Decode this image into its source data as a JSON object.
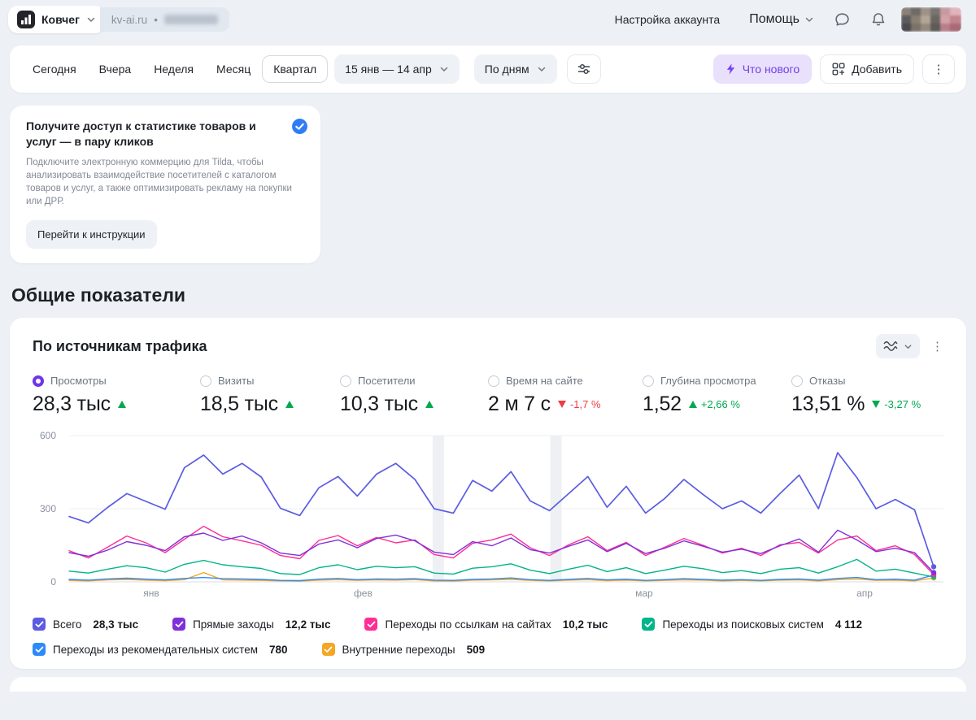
{
  "icons": {
    "kebab": "⋮"
  },
  "topbar": {
    "counter": {
      "name": "Ковчег",
      "domain": "kv-ai.ru",
      "separator": "•"
    },
    "account_settings_label": "Настройка аккаунта",
    "help_label": "Помощь"
  },
  "toolbar": {
    "tabs": [
      {
        "label": "Сегодня",
        "selected": false
      },
      {
        "label": "Вчера",
        "selected": false
      },
      {
        "label": "Неделя",
        "selected": false
      },
      {
        "label": "Месяц",
        "selected": false
      },
      {
        "label": "Квартал",
        "selected": true
      }
    ],
    "date_range_label": "15 янв — 14 апр",
    "granularity_label": "По дням",
    "whats_new_label": "Что нового",
    "add_label": "Добавить"
  },
  "promo": {
    "title": "Получите доступ к статистике товаров и услуг — в пару кликов",
    "body": "Подключите электронную коммерцию для Tilda, чтобы анализировать взаимодействие посетителей с каталогом товаров и услуг, а также оптимизировать рекламу на покупки или ДРР.",
    "cta_label": "Перейти к инструкции"
  },
  "section_title": "Общие показатели",
  "widget": {
    "title": "По источникам трафика",
    "metrics": [
      {
        "label": "Просмотры",
        "value": "28,3 тыс",
        "delta": "",
        "trend": "up",
        "trend_color": "green",
        "selected": true
      },
      {
        "label": "Визиты",
        "value": "18,5 тыс",
        "delta": "",
        "trend": "up",
        "trend_color": "green",
        "selected": false
      },
      {
        "label": "Посетители",
        "value": "10,3 тыс",
        "delta": "",
        "trend": "up",
        "trend_color": "green",
        "selected": false
      },
      {
        "label": "Время на сайте",
        "value": "2 м 7 с",
        "delta": "-1,7 %",
        "trend": "down",
        "trend_color": "red",
        "selected": false
      },
      {
        "label": "Глубина просмотра",
        "value": "1,52",
        "delta": "+2,66 %",
        "trend": "up",
        "trend_color": "green",
        "selected": false
      },
      {
        "label": "Отказы",
        "value": "13,51 %",
        "delta": "-3,27 %",
        "trend": "down",
        "trend_color": "green",
        "selected": false
      }
    ],
    "legend": [
      {
        "label": "Всего",
        "value": "28,3 тыс",
        "color": "#5b5ce2"
      },
      {
        "label": "Прямые заходы",
        "value": "12,2 тыс",
        "color": "#8030d9"
      },
      {
        "label": "Переходы по ссылкам на сайтах",
        "value": "10,2 тыс",
        "color": "#ff2d96"
      },
      {
        "label": "Переходы из поисковых систем",
        "value": "4 112",
        "color": "#00b58a"
      },
      {
        "label": "Переходы из рекомендательных систем",
        "value": "780",
        "color": "#2e8af6"
      },
      {
        "label": "Внутренние переходы",
        "value": "509",
        "color": "#f5a623"
      }
    ]
  },
  "chart_data": {
    "type": "line",
    "title": "По источникам трафика",
    "ylim": [
      0,
      600
    ],
    "y_ticks": [
      0,
      300,
      600
    ],
    "grid": true,
    "legend_position": "bottom",
    "x_tick_labels": [
      "янв",
      "фев",
      "мар",
      "апр"
    ],
    "x_tick_positions": [
      0.095,
      0.34,
      0.665,
      0.92
    ],
    "highlight_band_positions": [
      0.427,
      0.563
    ],
    "series": [
      {
        "name": "Всего",
        "color": "#5b5ce2",
        "values": [
          268,
          242,
          305,
          362,
          330,
          298,
          468,
          520,
          442,
          486,
          430,
          302,
          272,
          386,
          432,
          352,
          442,
          486,
          420,
          300,
          282,
          416,
          372,
          452,
          332,
          292,
          362,
          432,
          306,
          392,
          282,
          342,
          420,
          358,
          300,
          332,
          282,
          362,
          438,
          300,
          530,
          428,
          300,
          338,
          296,
          62
        ]
      },
      {
        "name": "Прямые заходы",
        "color": "#8030d9",
        "values": [
          120,
          105,
          130,
          165,
          150,
          128,
          185,
          200,
          170,
          188,
          160,
          118,
          108,
          155,
          172,
          140,
          178,
          192,
          168,
          122,
          112,
          165,
          148,
          180,
          132,
          118,
          146,
          172,
          124,
          158,
          116,
          138,
          168,
          146,
          122,
          134,
          116,
          148,
          176,
          122,
          212,
          172,
          124,
          138,
          120,
          38
        ]
      },
      {
        "name": "Переходы по ссылкам на сайтах",
        "color": "#ff2d96",
        "values": [
          128,
          98,
          142,
          188,
          160,
          120,
          175,
          228,
          185,
          168,
          150,
          108,
          95,
          170,
          190,
          148,
          182,
          160,
          172,
          112,
          98,
          158,
          172,
          196,
          140,
          108,
          152,
          185,
          128,
          162,
          108,
          142,
          178,
          150,
          118,
          138,
          108,
          152,
          162,
          118,
          172,
          188,
          128,
          148,
          112,
          30
        ]
      },
      {
        "name": "Переходы из поисковых систем",
        "color": "#00b58a",
        "values": [
          44,
          36,
          52,
          66,
          58,
          40,
          72,
          88,
          70,
          62,
          55,
          34,
          30,
          58,
          70,
          50,
          64,
          58,
          62,
          36,
          32,
          56,
          62,
          74,
          48,
          34,
          52,
          68,
          42,
          58,
          34,
          48,
          64,
          54,
          38,
          46,
          34,
          52,
          58,
          36,
          62,
          92,
          44,
          52,
          36,
          20
        ]
      },
      {
        "name": "Переходы из рекомендательных систем",
        "color": "#2e8af6",
        "values": [
          10,
          7,
          12,
          15,
          11,
          8,
          14,
          18,
          13,
          12,
          10,
          6,
          5,
          11,
          14,
          9,
          12,
          11,
          13,
          7,
          6,
          10,
          12,
          16,
          9,
          6,
          10,
          14,
          8,
          11,
          6,
          9,
          13,
          10,
          7,
          9,
          6,
          10,
          12,
          7,
          14,
          18,
          9,
          11,
          7,
          28
        ]
      },
      {
        "name": "Внутренние переходы",
        "color": "#f5a623",
        "values": [
          6,
          4,
          8,
          10,
          7,
          5,
          9,
          38,
          8,
          7,
          6,
          4,
          3,
          7,
          9,
          6,
          8,
          7,
          9,
          4,
          3,
          7,
          8,
          10,
          6,
          4,
          7,
          9,
          5,
          7,
          4,
          6,
          8,
          7,
          4,
          6,
          4,
          7,
          8,
          4,
          9,
          12,
          6,
          7,
          4,
          16
        ]
      }
    ]
  }
}
